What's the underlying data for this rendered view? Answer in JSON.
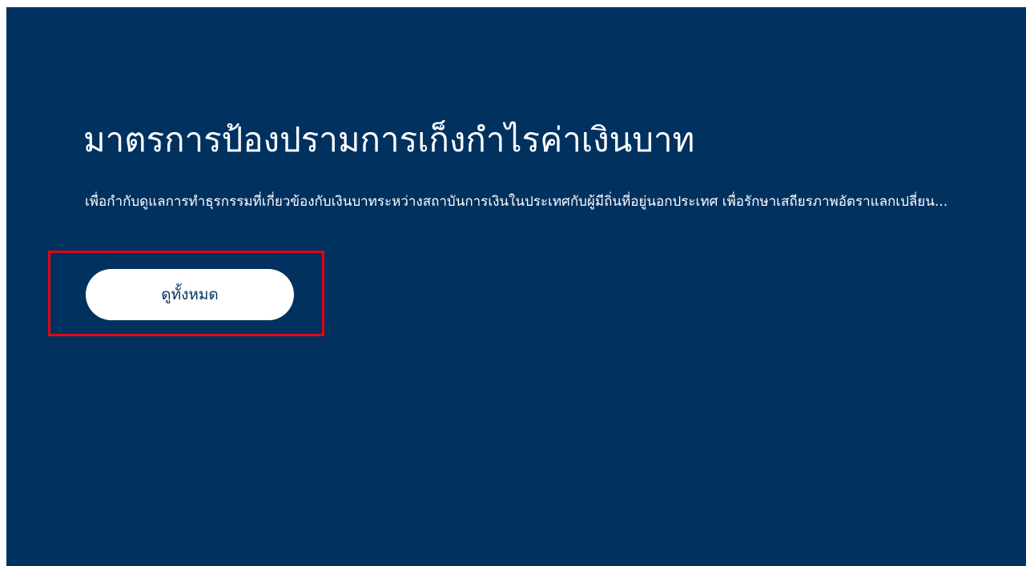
{
  "banner": {
    "title": "มาตรการป้องปรามการเก็งกำไรค่าเงินบาท",
    "description": "เพื่อกำกับดูแลการทำธุรกรรมที่เกี่ยวข้องกับเงินบาทระหว่างสถาบันการเงินในประเทศกับผู้มีถิ่นที่อยู่นอกประเทศ เพื่อรักษาเสถียรภาพอัตราแลกเปลี่ยน...",
    "view_all_label": "ดูทั้งหมด",
    "background_color": "#00315f",
    "highlight_color": "#e30613"
  }
}
